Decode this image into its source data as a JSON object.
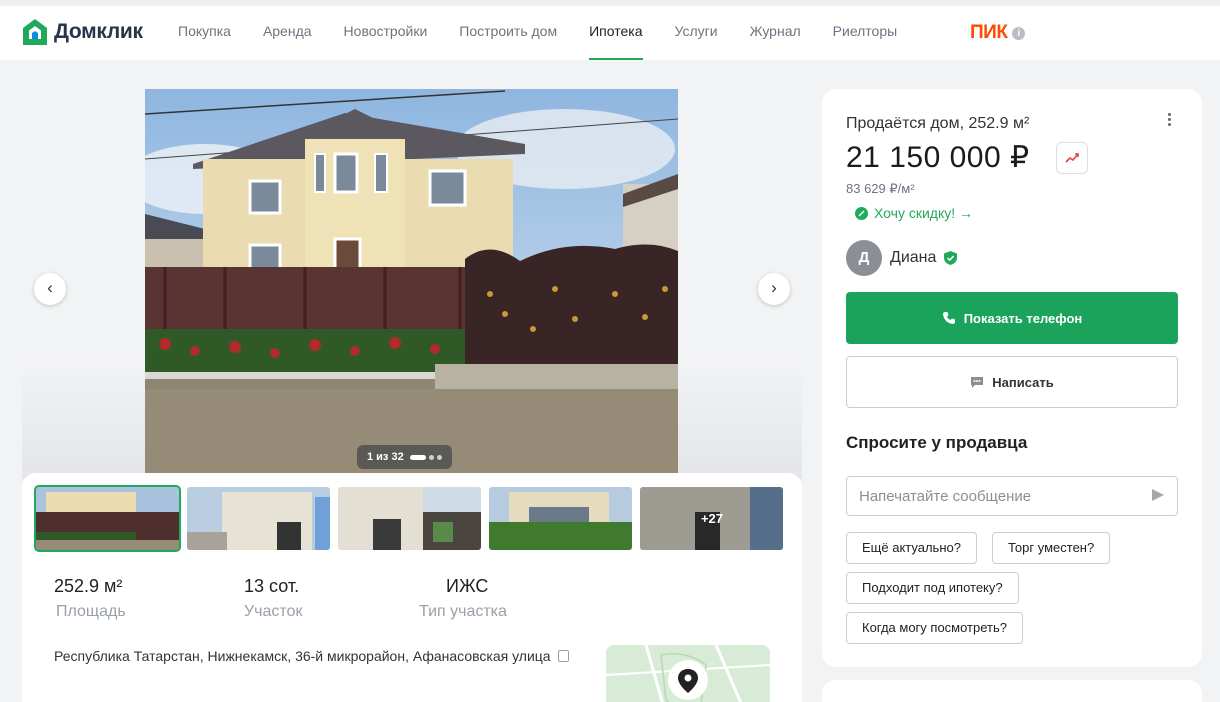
{
  "header": {
    "logo_text": "Домклик",
    "nav": [
      "Покупка",
      "Аренда",
      "Новостройки",
      "Построить дом",
      "Ипотека",
      "Услуги",
      "Журнал",
      "Риелторы"
    ],
    "active_nav": "Ипотека",
    "partner": "ПИК",
    "partner_info": "i"
  },
  "gallery": {
    "counter": "1 из 32",
    "prev": "‹",
    "next": "›",
    "more_photos": "+27"
  },
  "stats": [
    {
      "value": "252.9 м²",
      "label": "Площадь"
    },
    {
      "value": "13 сот.",
      "label": "Участок"
    },
    {
      "value": "ИЖС",
      "label": "Тип участка"
    }
  ],
  "address": "Республика Татарстан, Нижнекамск, 36-й микрорайон, Афанасовская улица",
  "offer": {
    "title": "Продаётся дом, 252.9 м²",
    "price": "21 150 000 ₽",
    "price_per_m2": "83 629 ₽/м²",
    "discount_link": "Хочу скидку! →"
  },
  "seller": {
    "initial": "Д",
    "name": "Диана"
  },
  "actions": {
    "phone": "Показать телефон",
    "write": "Написать"
  },
  "ask": {
    "title": "Спросите у продавца",
    "placeholder": "Напечатайте сообщение",
    "chips": [
      "Ещё актуально?",
      "Торг уместен?",
      "Подходит под ипотеку?",
      "Когда могу посмотреть?"
    ]
  },
  "colors": {
    "accent": "#21a95b",
    "button": "#1ba25b",
    "partner": "#fc4c02"
  }
}
